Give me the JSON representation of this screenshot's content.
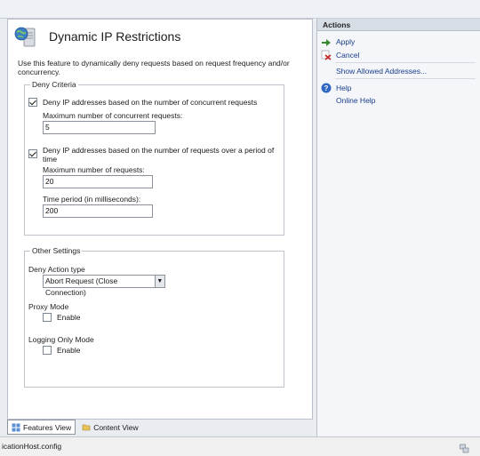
{
  "feature": {
    "title": "Dynamic IP Restrictions",
    "description": "Use this feature to dynamically deny requests based on request frequency and/or concurrency."
  },
  "deny_criteria": {
    "legend": "Deny Criteria",
    "concurrent": {
      "label": "Deny IP addresses based on the number of concurrent requests",
      "checked": true,
      "max_label": "Maximum number of concurrent requests:",
      "max_value": "5"
    },
    "rate": {
      "label": "Deny IP addresses based on the number of requests over a period of time",
      "checked": true,
      "max_label": "Maximum number of requests:",
      "max_value": "20",
      "period_label": "Time period (in milliseconds):",
      "period_value": "200"
    }
  },
  "other_settings": {
    "legend": "Other Settings",
    "deny_action_label": "Deny Action type",
    "deny_action_value": "Abort Request (Close Connection)",
    "proxy_mode_label": "Proxy Mode",
    "proxy_enable_label": "Enable",
    "logging_mode_label": "Logging Only Mode",
    "logging_enable_label": "Enable"
  },
  "view_tabs": [
    {
      "label": "Features View",
      "active": true
    },
    {
      "label": "Content View",
      "active": false
    }
  ],
  "actions": {
    "header": "Actions",
    "apply": "Apply",
    "cancel": "Cancel",
    "show_allowed": "Show Allowed Addresses...",
    "help": "Help",
    "online_help": "Online Help"
  },
  "status": {
    "path": "icationHost.config"
  },
  "icons": {
    "feature": "globe-server-icon",
    "apply": "apply-arrow-icon",
    "cancel": "cancel-x-icon",
    "help": "help-icon",
    "features_view": "features-view-icon",
    "content_view": "content-view-icon",
    "status": "network-status-icon"
  },
  "colors": {
    "link": "#1a3e8c",
    "actions_header": "#d7dde5",
    "pane_bg": "#f4f6f9"
  }
}
